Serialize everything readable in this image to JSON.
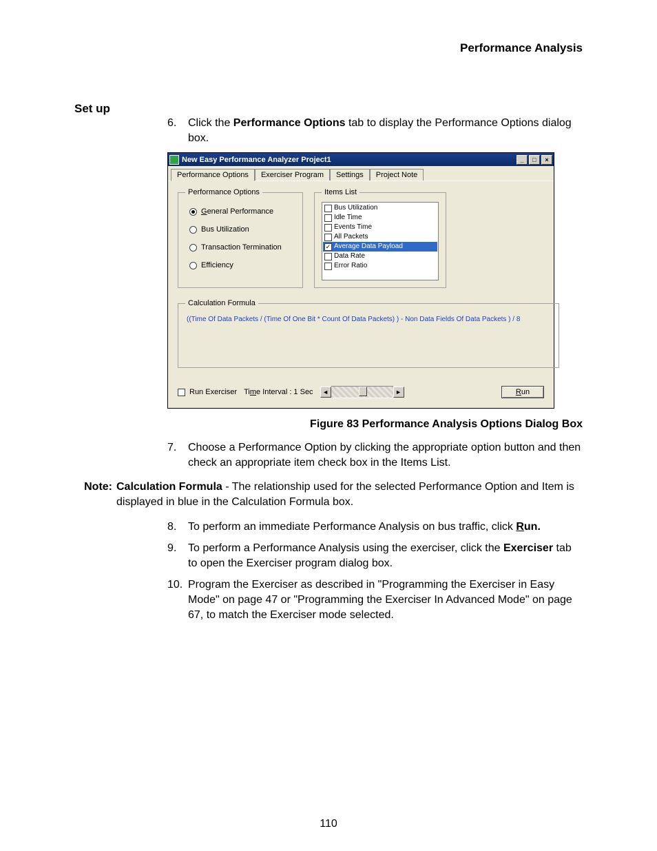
{
  "header": {
    "running": "Performance Analysis"
  },
  "section": {
    "setup": "Set up"
  },
  "steps": {
    "s6": {
      "num": "6.",
      "pre": "Click the ",
      "bold": "Performance Options",
      "post": " tab to display the Performance Options dialog box."
    },
    "s7": {
      "num": "7.",
      "text": "Choose a Performance Option by clicking the appropriate option button and then check an appropriate item check box in the Items List."
    },
    "s8": {
      "num": "8.",
      "pre": "To perform an immediate Performance Analysis on bus traffic, click ",
      "run_u": "R",
      "run_rest": "un."
    },
    "s9": {
      "num": "9.",
      "pre": "To perform a Performance Analysis using the exerciser, click the ",
      "bold": "Exerciser",
      "post": " tab to open the Exerciser program dialog box."
    },
    "s10": {
      "num": "10.",
      "text": "Program the Exerciser as described in \"Programming the Exerciser in Easy Mode\" on page 47 or \"Programming the Exerciser In Advanced Mode\" on page 67, to match the Exerciser mode selected."
    }
  },
  "figure": {
    "caption": "Figure  83   Performance Analysis Options Dialog Box"
  },
  "note": {
    "label": "Note:",
    "bold": "Calculation Formula",
    "rest": " - The relationship used for the selected Performance Option and Item is displayed in blue in the Calculation Formula box."
  },
  "page_number": "110",
  "dialog": {
    "title": "New Easy Performance Analyzer Project1",
    "winbtns": {
      "min": "_",
      "max": "□",
      "close": "×"
    },
    "tabs": [
      "Performance Options",
      "Exerciser Program",
      "Settings",
      "Project Note"
    ],
    "perf_legend": "Performance Options",
    "radios": [
      {
        "label_u": "G",
        "label_rest": "eneral Performance",
        "selected": true
      },
      {
        "label": "Bus Utilization",
        "selected": false
      },
      {
        "label": "Transaction Termination",
        "selected": false
      },
      {
        "label": "Efficiency",
        "selected": false
      }
    ],
    "items_legend": "Items List",
    "items": [
      {
        "label": "Bus Utilization",
        "checked": false,
        "selected": false
      },
      {
        "label": "Idle Time",
        "checked": false,
        "selected": false
      },
      {
        "label": "Events Time",
        "checked": false,
        "selected": false
      },
      {
        "label": "All Packets",
        "checked": false,
        "selected": false
      },
      {
        "label": "Average Data Payload",
        "checked": true,
        "selected": true
      },
      {
        "label": "Data Rate",
        "checked": false,
        "selected": false
      },
      {
        "label": "Error Ratio",
        "checked": false,
        "selected": false
      }
    ],
    "formula_legend": "Calculation Formula",
    "formula_text": "((Time Of Data Packets / (Time Of One Bit * Count Of Data Packets) ) - Non Data Fields Of Data Packets ) / 8",
    "run_exerciser": "Run Exerciser",
    "time_interval_pre": "Ti",
    "time_interval_u": "m",
    "time_interval_post": "e Interval : 1 Sec",
    "slider": {
      "left": "◄",
      "right": "►"
    },
    "run_u": "R",
    "run_rest": "un"
  }
}
